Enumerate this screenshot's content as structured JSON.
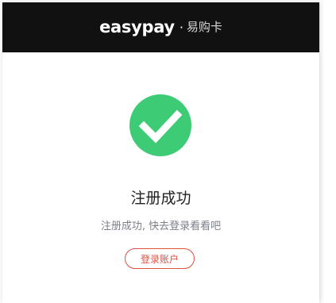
{
  "header": {
    "brand": "easypay",
    "separator": "·",
    "product": "易购卡"
  },
  "result": {
    "icon": "success-check-icon",
    "title": "注册成功",
    "message": "注册成功, 快去登录看看吧",
    "login_button_label": "登录账户"
  },
  "colors": {
    "header_bg": "#111111",
    "success_green": "#3ecb75",
    "accent_red": "#e0513f"
  }
}
